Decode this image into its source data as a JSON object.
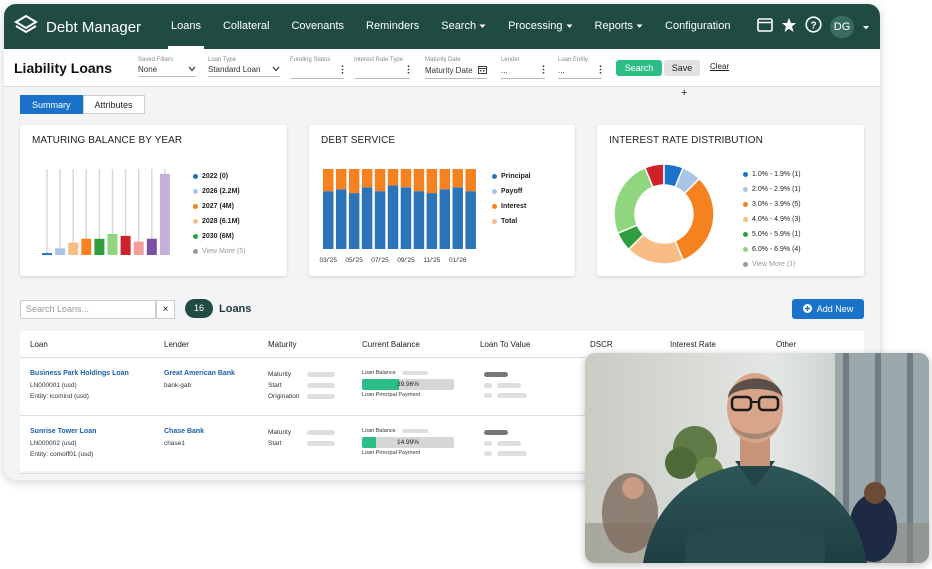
{
  "app": {
    "name": "Debt Manager",
    "user_initials": "DG"
  },
  "nav": [
    {
      "label": "Loans",
      "active": true
    },
    {
      "label": "Collateral",
      "active": false
    },
    {
      "label": "Covenants",
      "active": false
    },
    {
      "label": "Reminders",
      "active": false
    },
    {
      "label": "Search",
      "active": false,
      "dropdown": true
    },
    {
      "label": "Processing",
      "active": false,
      "dropdown": true
    },
    {
      "label": "Reports",
      "active": false,
      "dropdown": true
    },
    {
      "label": "Configuration",
      "active": false
    }
  ],
  "page": {
    "title": "Liability Loans"
  },
  "filters": [
    {
      "label": "Saved Filters",
      "value": "None",
      "icon": "chevron-down"
    },
    {
      "label": "Loan Type",
      "value": "Standard Loan",
      "icon": "chevron-down"
    },
    {
      "label": "Funding Status",
      "value": "",
      "icon": "kebab"
    },
    {
      "label": "Interest Rate Type",
      "value": "",
      "icon": "kebab"
    },
    {
      "label": "Maturity Date",
      "value": "Maturity Date",
      "icon": "calendar"
    },
    {
      "label": "Lender",
      "value": "...",
      "icon": "kebab"
    },
    {
      "label": "Loan Entity",
      "value": "...",
      "icon": "kebab"
    }
  ],
  "buttons": {
    "search": "Search",
    "save": "Save",
    "clear": "Clear",
    "add_new": "Add New"
  },
  "tabs": [
    {
      "label": "Summary",
      "active": true
    },
    {
      "label": "Attributes",
      "active": false
    }
  ],
  "cards": {
    "maturing": {
      "title": "MATURING BALANCE BY YEAR"
    },
    "debt_service": {
      "title": "DEBT SERVICE"
    },
    "interest": {
      "title": "INTEREST RATE DISTRIBUTION"
    }
  },
  "chart_data": [
    {
      "type": "bar",
      "title": "MATURING BALANCE BY YEAR",
      "legend": [
        "2022 (0)",
        "2026 (2.2M)",
        "2027 (4M)",
        "2028 (6.1M)",
        "2030 (6M)",
        "View More (5)"
      ],
      "legend_colors": [
        "#1b73c9",
        "#a8c5e8",
        "#f5821f",
        "#f9bc85",
        "#2e9e3e",
        "#999999"
      ],
      "values": [
        0.2,
        0.7,
        1.3,
        1.7,
        1.7,
        2.2,
        2.0,
        1.4,
        1.7,
        8.5
      ],
      "colors": [
        "#1b73c9",
        "#a8c5e8",
        "#f9bc85",
        "#f5821f",
        "#2e9e3e",
        "#8fd67f",
        "#cc2229",
        "#f59c9c",
        "#7b4fa3",
        "#c4b0d8"
      ],
      "ylim": [
        0,
        9
      ]
    },
    {
      "type": "bar",
      "title": "DEBT SERVICE",
      "stacked": true,
      "categories": [
        "03/'25",
        "04/'25",
        "05/'25",
        "06/'25",
        "07/'25",
        "08/'25",
        "09/'25",
        "10/'25",
        "11/'25",
        "12/'25",
        "01/'26",
        "02/'26"
      ],
      "tick_labels": [
        "03/'25",
        "05/'25",
        "07/'25",
        "09/'25",
        "11/'25",
        "01/'26"
      ],
      "legend": [
        "Principal",
        "Payoff",
        "Interest",
        "Total"
      ],
      "legend_colors": [
        "#2b74b8",
        "#a8c5e8",
        "#f5821f",
        "#f9bc85"
      ],
      "series": [
        {
          "name": "Principal",
          "values": [
            60,
            62,
            58,
            64,
            60,
            66,
            64,
            60,
            58,
            62,
            64,
            60
          ],
          "color": "#2b74b8"
        },
        {
          "name": "Interest",
          "values": [
            23,
            21,
            25,
            19,
            23,
            17,
            19,
            23,
            25,
            21,
            19,
            23
          ],
          "color": "#f5821f"
        }
      ],
      "ylim": [
        0,
        83
      ]
    },
    {
      "type": "pie",
      "title": "INTEREST RATE DISTRIBUTION",
      "donut": true,
      "labels": [
        "1.0% - 1.9% (1)",
        "2.0% - 2.9% (1)",
        "3.0% - 3.9% (5)",
        "4.0% - 4.9% (3)",
        "5.0% - 5.9% (1)",
        "6.0% - 6.9% (4)",
        "View More (1)"
      ],
      "values": [
        1,
        1,
        5,
        3,
        1,
        4,
        1
      ],
      "colors": [
        "#1b73c9",
        "#a8c5e8",
        "#f5821f",
        "#f9bc85",
        "#2e9e3e",
        "#8fd67f",
        "#cc2229"
      ],
      "legend_colors": [
        "#1b73c9",
        "#a8c5e8",
        "#f5821f",
        "#f9bc85",
        "#2e9e3e",
        "#8fd67f",
        "#999999"
      ]
    }
  ],
  "search": {
    "placeholder": "Search Loans...",
    "clear_icon": "×"
  },
  "loans": {
    "count": "16",
    "label": "Loans"
  },
  "table": {
    "columns": [
      "Loan",
      "Lender",
      "Maturity",
      "Current Balance",
      "Loan To Value",
      "DSCR",
      "Interest Rate",
      "Other"
    ],
    "rows": [
      {
        "loan_name": "Business Park Holdings Loan",
        "loan_id": "LN000001 (usd)",
        "entity": "Entity: icomind (usd)",
        "lender": "Great American Bank",
        "lender_code": "bank-gab",
        "maturity_labels": [
          "Maturity",
          "Start",
          "Origination"
        ],
        "balance_label": "Loan Balance",
        "balance_pct": "39.96%",
        "balance_value": 0.3996,
        "principal_label": "Loan Principal Payment"
      },
      {
        "loan_name": "Sunrise Tower Loan",
        "loan_id": "LN000002 (usd)",
        "entity": "Entity: comoff01 (usd)",
        "lender": "Chase Bank",
        "lender_code": "chase1",
        "maturity_labels": [
          "Maturity",
          "Start"
        ],
        "balance_label": "Loan Balance",
        "balance_pct": "14.99%",
        "balance_value": 0.1499,
        "principal_label": "Loan Principal Payment"
      }
    ]
  },
  "colors": {
    "nav_bg": "#1f4b43",
    "accent_green": "#2bbf87",
    "accent_blue": "#1b73c9"
  }
}
